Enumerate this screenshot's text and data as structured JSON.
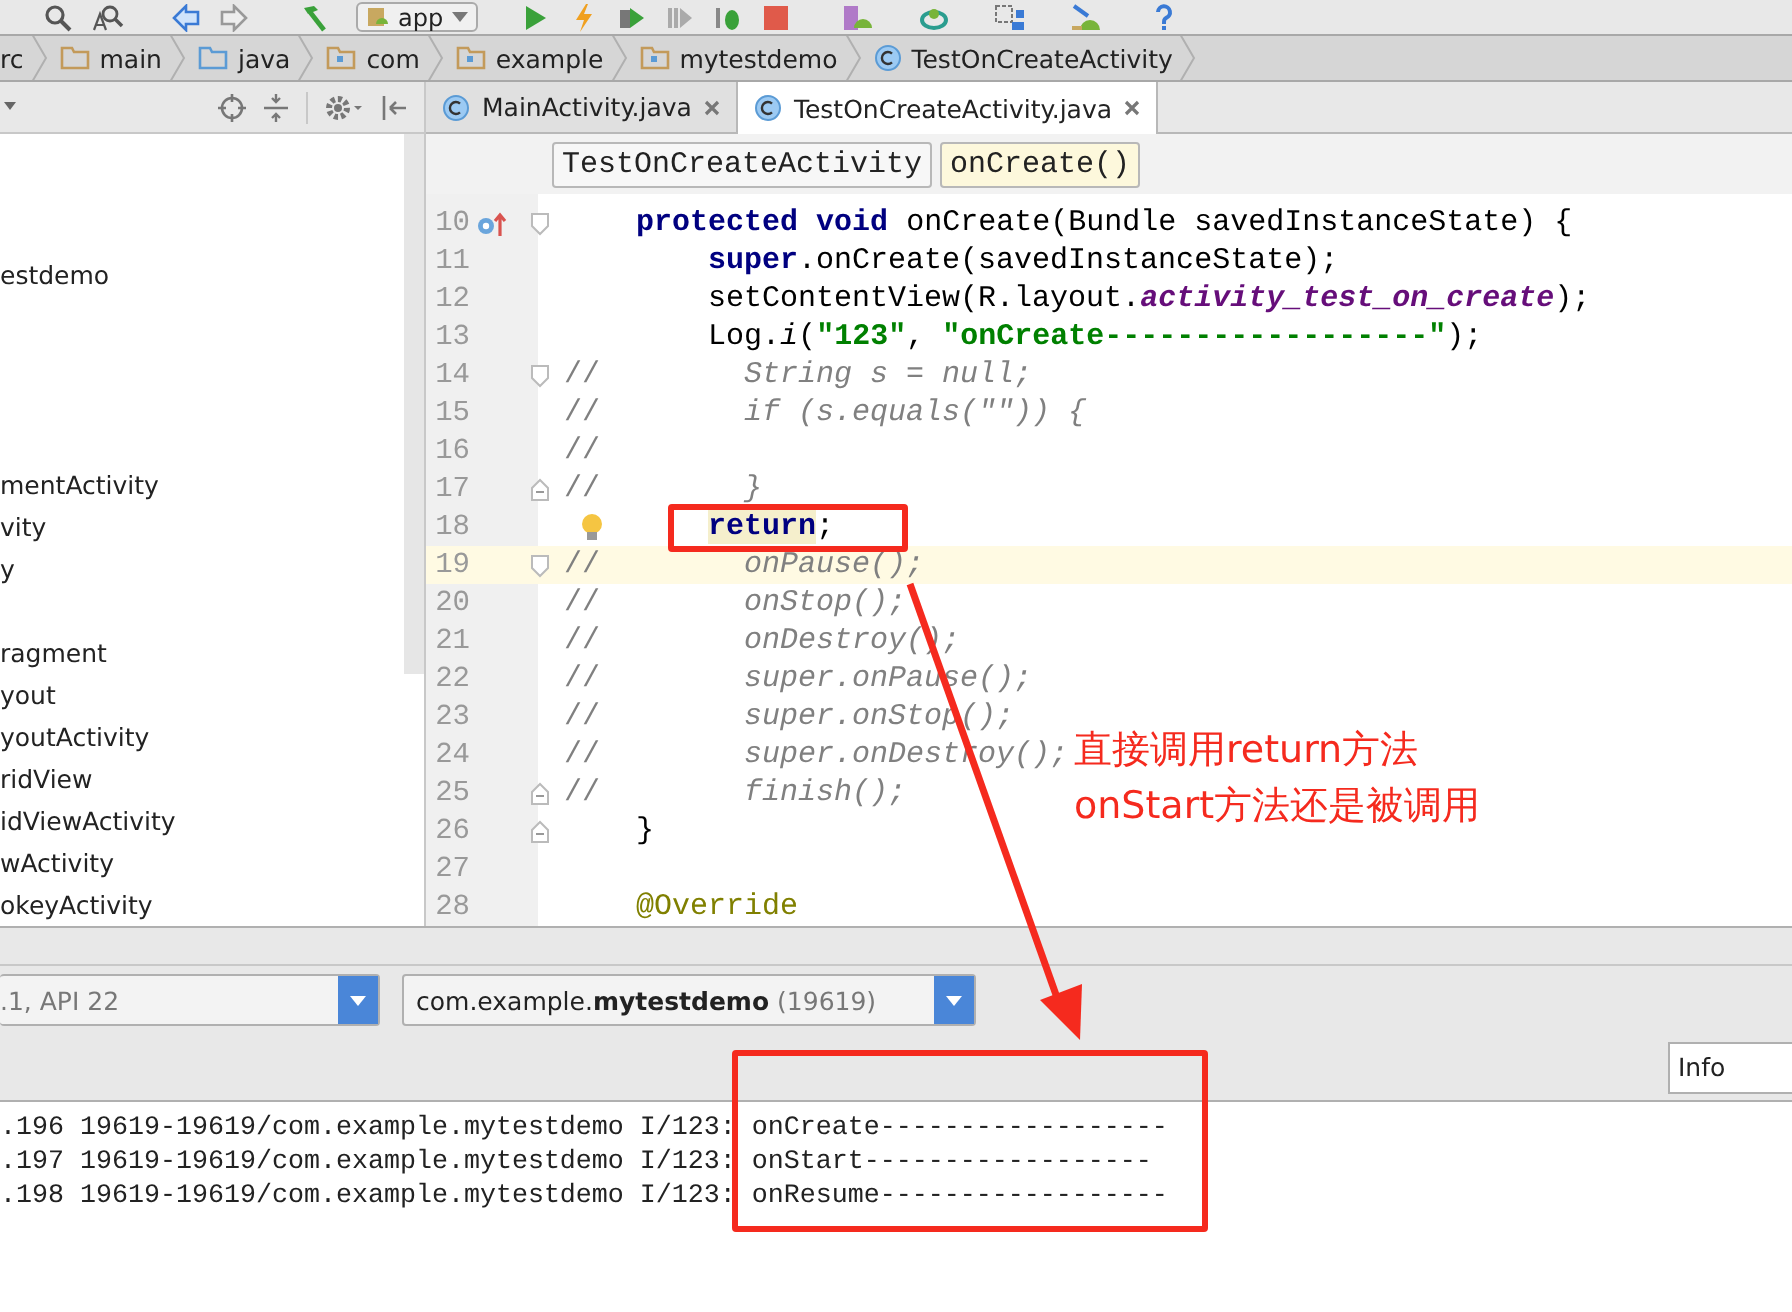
{
  "toolbar": {
    "run_config": "app"
  },
  "breadcrumbs": [
    {
      "label": "rc",
      "kind": "plain"
    },
    {
      "label": "main",
      "kind": "folder"
    },
    {
      "label": "java",
      "kind": "source-folder"
    },
    {
      "label": "com",
      "kind": "package"
    },
    {
      "label": "example",
      "kind": "package"
    },
    {
      "label": "mytestdemo",
      "kind": "package"
    },
    {
      "label": "TestOnCreateActivity",
      "kind": "class"
    }
  ],
  "project_tree": {
    "items": [
      "estdemo",
      "mentActivity",
      "vity",
      "y",
      "ragment",
      "yout",
      "youtActivity",
      "ridView",
      "idViewActivity",
      "wActivity",
      "okeyActivity"
    ]
  },
  "editor_tabs": [
    {
      "label": "MainActivity.java",
      "selected": false
    },
    {
      "label": "TestOnCreateActivity.java",
      "selected": true
    }
  ],
  "editor_breadcrumbs": [
    {
      "label": "TestOnCreateActivity",
      "selected": false
    },
    {
      "label": "onCreate()",
      "selected": true
    }
  ],
  "code_lines": [
    {
      "number": "10",
      "current": false,
      "override_marker": true,
      "bulb": false,
      "fold_start": true,
      "fold_end": false,
      "tokens": [
        {
          "kind": "kw",
          "text": "    protected"
        },
        {
          "kind": "kw",
          "text": " void"
        },
        {
          "kind": "plain",
          "text": " onCreate(Bundle savedInstanceState) {"
        }
      ]
    },
    {
      "number": "11",
      "current": false,
      "override_marker": false,
      "bulb": false,
      "fold_start": false,
      "fold_end": false,
      "tokens": [
        {
          "kind": "kw",
          "text": "        super"
        },
        {
          "kind": "plain",
          "text": ".onCreate(savedInstanceState);"
        }
      ]
    },
    {
      "number": "12",
      "current": false,
      "override_marker": false,
      "bulb": false,
      "fold_start": false,
      "fold_end": false,
      "tokens": [
        {
          "kind": "plain",
          "text": "        setContentView(R.layout."
        },
        {
          "kind": "field",
          "text": "activity_test_on_create"
        },
        {
          "kind": "plain",
          "text": ");"
        }
      ]
    },
    {
      "number": "13",
      "current": false,
      "override_marker": false,
      "bulb": false,
      "fold_start": false,
      "fold_end": false,
      "tokens": [
        {
          "kind": "plain",
          "text": "        Log."
        },
        {
          "kind": "static",
          "text": "i"
        },
        {
          "kind": "plain",
          "text": "("
        },
        {
          "kind": "str",
          "text": "\"123\""
        },
        {
          "kind": "plain",
          "text": ", "
        },
        {
          "kind": "str",
          "text": "\"onCreate------------------\""
        },
        {
          "kind": "plain",
          "text": ");"
        }
      ]
    },
    {
      "number": "14",
      "current": false,
      "override_marker": false,
      "bulb": false,
      "fold_start": true,
      "fold_end": false,
      "tokens": [
        {
          "kind": "comment-mark",
          "text": "//"
        },
        {
          "kind": "comment",
          "text": "        String s = null;"
        }
      ]
    },
    {
      "number": "15",
      "current": false,
      "override_marker": false,
      "bulb": false,
      "fold_start": false,
      "fold_end": false,
      "tokens": [
        {
          "kind": "comment-mark",
          "text": "//"
        },
        {
          "kind": "comment",
          "text": "        if (s.equals(\"\")) {"
        }
      ]
    },
    {
      "number": "16",
      "current": false,
      "override_marker": false,
      "bulb": false,
      "fold_start": false,
      "fold_end": false,
      "tokens": [
        {
          "kind": "comment-mark",
          "text": "//"
        }
      ]
    },
    {
      "number": "17",
      "current": false,
      "override_marker": false,
      "bulb": false,
      "fold_start": false,
      "fold_end": true,
      "tokens": [
        {
          "kind": "comment-mark",
          "text": "//"
        },
        {
          "kind": "comment",
          "text": "        }"
        }
      ]
    },
    {
      "number": "18",
      "current": false,
      "override_marker": false,
      "bulb": true,
      "fold_start": false,
      "fold_end": false,
      "tokens": [
        {
          "kind": "kw-hl",
          "text": "        return"
        },
        {
          "kind": "plain",
          "text": ";"
        }
      ]
    },
    {
      "number": "19",
      "current": true,
      "override_marker": false,
      "bulb": false,
      "fold_start": true,
      "fold_end": false,
      "tokens": [
        {
          "kind": "comment-mark",
          "text": "//"
        },
        {
          "kind": "comment",
          "text": "        onPause();"
        }
      ]
    },
    {
      "number": "20",
      "current": false,
      "override_marker": false,
      "bulb": false,
      "fold_start": false,
      "fold_end": false,
      "tokens": [
        {
          "kind": "comment-mark",
          "text": "//"
        },
        {
          "kind": "comment",
          "text": "        onStop();"
        }
      ]
    },
    {
      "number": "21",
      "current": false,
      "override_marker": false,
      "bulb": false,
      "fold_start": false,
      "fold_end": false,
      "tokens": [
        {
          "kind": "comment-mark",
          "text": "//"
        },
        {
          "kind": "comment",
          "text": "        onDestroy();"
        }
      ]
    },
    {
      "number": "22",
      "current": false,
      "override_marker": false,
      "bulb": false,
      "fold_start": false,
      "fold_end": false,
      "tokens": [
        {
          "kind": "comment-mark",
          "text": "//"
        },
        {
          "kind": "comment",
          "text": "        super.onPause();"
        }
      ]
    },
    {
      "number": "23",
      "current": false,
      "override_marker": false,
      "bulb": false,
      "fold_start": false,
      "fold_end": false,
      "tokens": [
        {
          "kind": "comment-mark",
          "text": "//"
        },
        {
          "kind": "comment",
          "text": "        super.onStop();"
        }
      ]
    },
    {
      "number": "24",
      "current": false,
      "override_marker": false,
      "bulb": false,
      "fold_start": false,
      "fold_end": false,
      "tokens": [
        {
          "kind": "comment-mark",
          "text": "//"
        },
        {
          "kind": "comment",
          "text": "        super.onDestroy();"
        }
      ]
    },
    {
      "number": "25",
      "current": false,
      "override_marker": false,
      "bulb": false,
      "fold_start": false,
      "fold_end": true,
      "tokens": [
        {
          "kind": "comment-mark",
          "text": "//"
        },
        {
          "kind": "comment",
          "text": "        finish();"
        }
      ]
    },
    {
      "number": "26",
      "current": false,
      "override_marker": false,
      "bulb": false,
      "fold_start": false,
      "fold_end": true,
      "tokens": [
        {
          "kind": "plain",
          "text": "    }"
        }
      ]
    },
    {
      "number": "27",
      "current": false,
      "override_marker": false,
      "bulb": false,
      "fold_start": false,
      "fold_end": false
    },
    {
      "number": "28",
      "current": false,
      "override_marker": false,
      "bulb": false,
      "fold_start": false,
      "fold_end": false,
      "tokens": [
        {
          "kind": "annot",
          "text": "    @Override"
        }
      ]
    }
  ],
  "annotation": {
    "lines": [
      "直接调用return方法",
      "onStart方法还是被调用"
    ]
  },
  "logcat": {
    "device": ".1, API 22",
    "process": {
      "prefix": "com.example.",
      "name": "mytestdemo",
      "pid": "(19619)"
    },
    "level": "Info",
    "lines": [
      ".196 19619-19619/com.example.mytestdemo I/123: onCreate------------------",
      ".197 19619-19619/com.example.mytestdemo I/123: onStart------------------",
      ".198 19619-19619/com.example.mytestdemo I/123: onResume------------------"
    ]
  }
}
